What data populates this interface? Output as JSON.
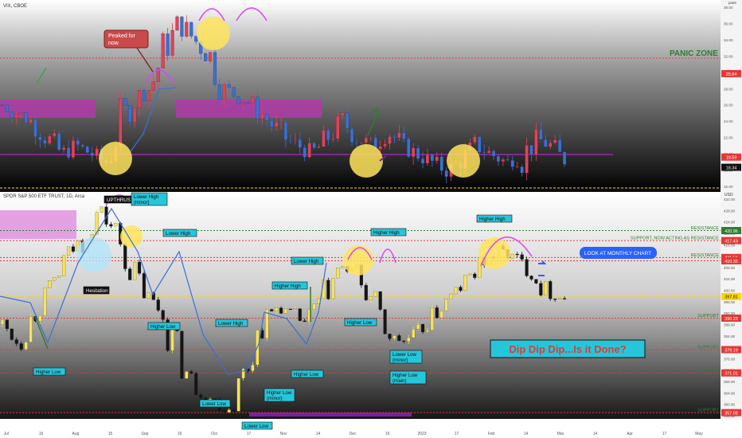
{
  "top_panel": {
    "symbol": "VIX, CBOE",
    "axis_unit": "point",
    "ticks": [
      "38.00",
      "36.00",
      "34.00",
      "32.00",
      "30.00",
      "28.00",
      "26.00",
      "24.00",
      "22.00",
      "20.00",
      "18.00",
      "16.00"
    ],
    "price_tags": [
      {
        "label": "29.84",
        "color": "#e53935"
      },
      {
        "label": "19.59",
        "color": "#e53935"
      },
      {
        "label": "18.34",
        "color": "#111111"
      }
    ],
    "annotations": {
      "panic_zone": "PANIC ZONE",
      "peaked": "Peaked for now"
    }
  },
  "bottom_panel": {
    "symbol": "SPDR S&P 500 ETF TRUST, 1D, Arca",
    "currency": "USD",
    "ticks": [
      "432.00",
      "428.00",
      "424.00",
      "420.00",
      "416.00",
      "412.00",
      "408.00",
      "404.00",
      "400.00",
      "396.00",
      "392.00",
      "388.00",
      "384.00",
      "380.00",
      "376.00",
      "372.00",
      "368.00",
      "364.00",
      "360.00",
      "356.00"
    ],
    "price_tags": [
      {
        "label": "420.96",
        "color": "#2e7d32"
      },
      {
        "label": "417.43",
        "color": "#e53935"
      },
      {
        "label": "411.51",
        "color": "#e53935"
      },
      {
        "label": "410.35",
        "color": "#e53935"
      },
      {
        "label": "397.81",
        "color": "#ffd600"
      },
      {
        "label": "390.23",
        "color": "#e53935"
      },
      {
        "label": "379.19",
        "color": "#e53935"
      },
      {
        "label": "371.01",
        "color": "#e53935"
      },
      {
        "label": "357.08",
        "color": "#e53935"
      }
    ],
    "level_labels": {
      "resistance1": "RESISTANCE",
      "support_resistance": "SUPPORT, NOW ACTING AS RESISTANCE",
      "resistance2": "RESISTANCE",
      "support1": "SUPPORT",
      "support2": "SUPPORT",
      "support3": "SUPPORT",
      "support4": "SUPPORT"
    },
    "callouts": {
      "upthrust": "UPTHRUST",
      "lower_high_minor": "Lower High (minor)",
      "lower_high_1": "Lower High",
      "higher_high_1": "Higher High",
      "higher_high_2": "Higher High",
      "lower_high_2": "Lower High",
      "higher_high_3": "Higher High",
      "hesitation": "Hesitation",
      "higher_low_1": "Higher Low",
      "higher_low_2": "Higher Low",
      "lower_high_3": "Lower High",
      "higher_low_3": "Higher Low",
      "higher_low_4": "Higher Low",
      "lower_low_1": "Lower Low",
      "lower_low_minor": "Lower Low (minor)",
      "higher_low_minor": "Higher Low (minor)",
      "higher_low_main": "Higher Low (main)",
      "lower_low_2": "Lower Low",
      "look_monthly": "LOOK AT MONTHLY CHART",
      "dip": "Dip Dip Dip...Is it Done?"
    }
  },
  "time_axis": [
    "Jul",
    "19",
    "Aug",
    "15",
    "Sep",
    "19",
    "Oct",
    "17",
    "Nov",
    "14",
    "Dec",
    "19",
    "2023",
    "17",
    "Feb",
    "14",
    "Mar",
    "14",
    "Apr",
    "17",
    "May"
  ],
  "chart_data": [
    {
      "type": "line",
      "title": "VIX, CBOE",
      "ylim": [
        16,
        38
      ],
      "x": [
        "Jul",
        "19",
        "Aug",
        "15",
        "Sep",
        "19",
        "Oct",
        "17",
        "Nov",
        "14",
        "Dec",
        "19",
        "2023",
        "17",
        "Feb",
        "14",
        "Mar"
      ],
      "values": [
        26,
        25,
        24,
        22,
        20,
        21,
        20,
        19,
        24,
        27,
        28,
        33,
        36,
        34,
        32,
        28,
        27,
        26,
        24,
        22,
        21,
        20,
        22,
        24,
        22,
        21,
        23,
        21,
        20,
        19,
        18,
        19,
        21,
        20,
        19,
        19,
        22,
        21,
        19
      ],
      "horizontal_levels": [
        29.84,
        19.59,
        18.34
      ]
    },
    {
      "type": "line",
      "title": "SPDR S&P 500 ETF TRUST, 1D, Arca",
      "ylim": [
        356,
        432
      ],
      "x": [
        "Jul",
        "19",
        "Aug",
        "15",
        "Sep",
        "19",
        "Oct",
        "17",
        "Nov",
        "14",
        "Dec",
        "19",
        "2023",
        "17",
        "Feb",
        "14",
        "Mar"
      ],
      "values": [
        388,
        382,
        392,
        400,
        412,
        418,
        428,
        421,
        408,
        398,
        392,
        376,
        365,
        362,
        358,
        370,
        386,
        394,
        392,
        388,
        398,
        408,
        406,
        396,
        384,
        382,
        386,
        392,
        398,
        404,
        410,
        414,
        411,
        406,
        398,
        397
      ],
      "horizontal_levels": [
        420.96,
        417.43,
        411.51,
        410.35,
        397.81,
        390.23,
        379.19,
        371.01,
        357.08
      ]
    }
  ]
}
